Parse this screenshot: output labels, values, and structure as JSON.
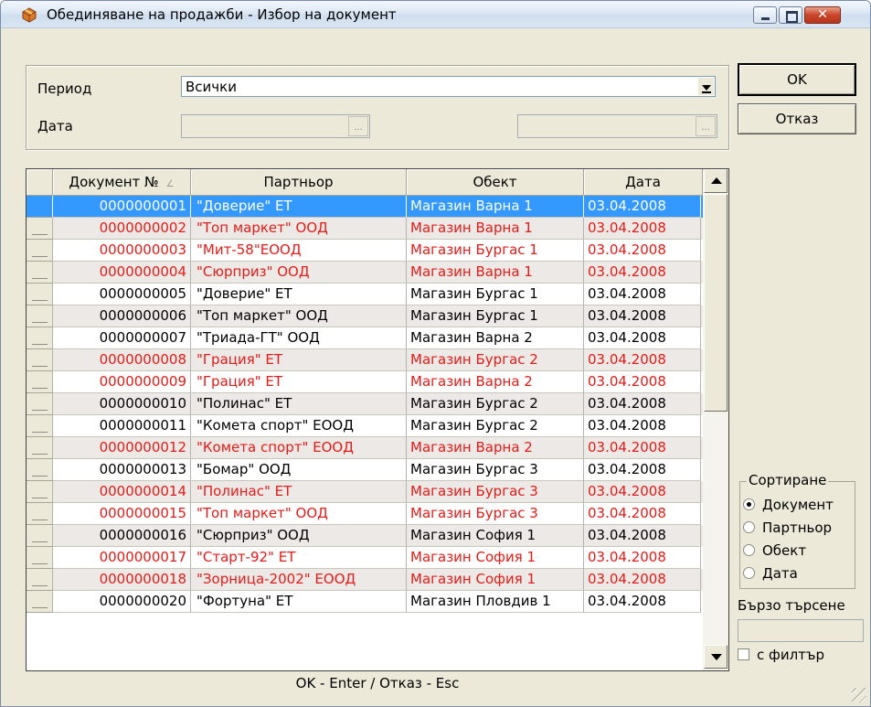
{
  "window": {
    "title": "Обединяване на продажби - Избор на документ",
    "close_glyph": "✕"
  },
  "filters": {
    "period_label": "Период",
    "period_value": "Всички",
    "date_label": "Дата",
    "date_from": "",
    "date_to": "",
    "picker_glyph": "..."
  },
  "buttons": {
    "ok": "OK",
    "cancel": "Отказ"
  },
  "table": {
    "columns": [
      "Документ №",
      "Партньор",
      "Обект",
      "Дата"
    ],
    "sort_glyph": "∠",
    "rows": [
      {
        "doc": "0000000001",
        "partner": "\"Доверие\" ЕТ",
        "object": "Магазин Варна 1",
        "date": "03.04.2008",
        "style": "sel"
      },
      {
        "doc": "0000000002",
        "partner": "\"Топ маркет\" ООД",
        "object": "Магазин Варна 1",
        "date": "03.04.2008",
        "style": "red"
      },
      {
        "doc": "0000000003",
        "partner": "\"Мит-58\"ЕООД",
        "object": "Магазин Бургас 1",
        "date": "03.04.2008",
        "style": "red"
      },
      {
        "doc": "0000000004",
        "partner": "\"Сюрприз\" ООД",
        "object": "Магазин Варна 1",
        "date": "03.04.2008",
        "style": "red"
      },
      {
        "doc": "0000000005",
        "partner": "\"Доверие\" ЕТ",
        "object": "Магазин Бургас 1",
        "date": "03.04.2008",
        "style": "black"
      },
      {
        "doc": "0000000006",
        "partner": "\"Топ маркет\" ООД",
        "object": "Магазин Бургас 1",
        "date": "03.04.2008",
        "style": "black"
      },
      {
        "doc": "0000000007",
        "partner": "\"Триада-ГТ\" ООД",
        "object": "Магазин Варна 2",
        "date": "03.04.2008",
        "style": "black"
      },
      {
        "doc": "0000000008",
        "partner": "\"Грация\" ЕТ",
        "object": "Магазин Бургас 2",
        "date": "03.04.2008",
        "style": "red"
      },
      {
        "doc": "0000000009",
        "partner": "\"Грация\" ЕТ",
        "object": "Магазин Варна 2",
        "date": "03.04.2008",
        "style": "red"
      },
      {
        "doc": "0000000010",
        "partner": "\"Полинас\" ЕТ",
        "object": "Магазин Бургас 2",
        "date": "03.04.2008",
        "style": "black"
      },
      {
        "doc": "0000000011",
        "partner": "\"Комета спорт\" ЕООД",
        "object": "Магазин Бургас 2",
        "date": "03.04.2008",
        "style": "black"
      },
      {
        "doc": "0000000012",
        "partner": "\"Комета спорт\" ЕООД",
        "object": "Магазин Варна 2",
        "date": "03.04.2008",
        "style": "red"
      },
      {
        "doc": "0000000013",
        "partner": "\"Бомар\" ООД",
        "object": "Магазин Бургас 3",
        "date": "03.04.2008",
        "style": "black"
      },
      {
        "doc": "0000000014",
        "partner": "\"Полинас\" ЕТ",
        "object": "Магазин Бургас 3",
        "date": "03.04.2008",
        "style": "red"
      },
      {
        "doc": "0000000015",
        "partner": "\"Топ маркет\" ООД",
        "object": "Магазин Бургас 3",
        "date": "03.04.2008",
        "style": "red"
      },
      {
        "doc": "0000000016",
        "partner": "\"Сюрприз\" ООД",
        "object": "Магазин София 1",
        "date": "03.04.2008",
        "style": "black"
      },
      {
        "doc": "0000000017",
        "partner": "\"Старт-92\" ЕТ",
        "object": "Магазин София 1",
        "date": "03.04.2008",
        "style": "red"
      },
      {
        "doc": "0000000018",
        "partner": "\"Зорница-2002\" ЕООД",
        "object": "Магазин София 1",
        "date": "03.04.2008",
        "style": "red"
      },
      {
        "doc": "0000000020",
        "partner": "\"Фортуна\" ЕТ",
        "object": "Магазин Пловдив 1",
        "date": "03.04.2008",
        "style": "black"
      }
    ]
  },
  "sorting": {
    "title": "Сортиране",
    "options": [
      "Документ",
      "Партньор",
      "Обект",
      "Дата"
    ],
    "selected": "Документ"
  },
  "quick_search": {
    "label": "Бързо търсене",
    "value": "",
    "filter_label": "с филтър",
    "filter_checked": false
  },
  "hint": "OK - Enter / Отказ - Esc",
  "colors": {
    "highlight_text": "#e41b17",
    "selection": "#3399ff"
  }
}
